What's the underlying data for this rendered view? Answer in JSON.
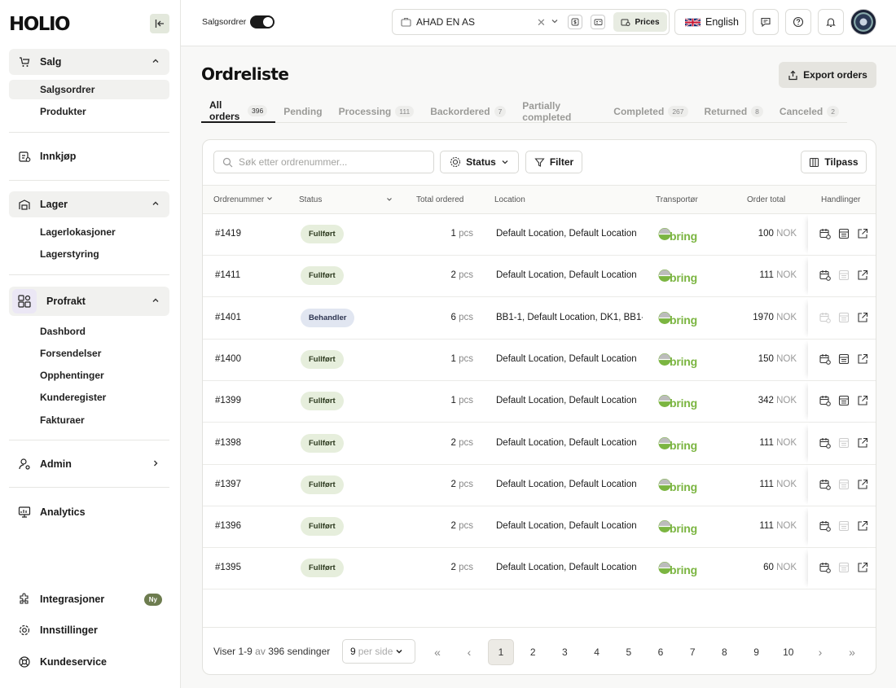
{
  "app": {
    "logo": "HOLIO"
  },
  "sidebar": {
    "groups": {
      "salg": "Salg",
      "innkjop": "Innkjøp",
      "lager": "Lager",
      "profrakt": "Profrakt",
      "admin": "Admin",
      "analytics": "Analytics",
      "integrasjoner": "Integrasjoner",
      "innstillinger": "Innstillinger",
      "kundeservice": "Kundeservice"
    },
    "salg_items": [
      "Salgsordrer",
      "Produkter"
    ],
    "lager_items": [
      "Lagerlokasjoner",
      "Lagerstyring"
    ],
    "profrakt_items": [
      "Dashbord",
      "Forsendelser",
      "Opphentinger",
      "Kunderegister",
      "Fakturaer"
    ],
    "new_badge": "Ny"
  },
  "topbar": {
    "toggle_label": "Salgsordrer",
    "company": "AHAD EN AS",
    "prices_label": "Prices",
    "language": "English"
  },
  "page": {
    "title": "Ordreliste",
    "export_label": "Export orders"
  },
  "tabs": [
    {
      "label": "All orders",
      "count": "396"
    },
    {
      "label": "Pending",
      "count": ""
    },
    {
      "label": "Processing",
      "count": "111"
    },
    {
      "label": "Backordered",
      "count": "7"
    },
    {
      "label": "Partially completed",
      "count": ""
    },
    {
      "label": "Completed",
      "count": "267"
    },
    {
      "label": "Returned",
      "count": "8"
    },
    {
      "label": "Canceled",
      "count": "2"
    }
  ],
  "toolbar": {
    "search_placeholder": "Søk etter ordrenummer...",
    "status_label": "Status",
    "filter_label": "Filter",
    "customize_label": "Tilpass"
  },
  "table": {
    "headers": [
      "Ordrenummer",
      "Status",
      "Total ordered",
      "Location",
      "Transportør",
      "Order total",
      "Handlinger"
    ],
    "carrier_name": "bring",
    "rows": [
      {
        "order": "#1419",
        "status": "Fullført",
        "qty": "1",
        "unit": "pcs",
        "location": "Default Location, Default Location",
        "total": "100",
        "currency": "NOK"
      },
      {
        "order": "#1411",
        "status": "Fullført",
        "qty": "2",
        "unit": "pcs",
        "location": "Default Location, Default Location",
        "total": "111",
        "currency": "NOK"
      },
      {
        "order": "#1401",
        "status": "Behandler",
        "qty": "6",
        "unit": "pcs",
        "location": "BB1-1, Default Location, DK1, BB1-",
        "total": "1970",
        "currency": "NOK"
      },
      {
        "order": "#1400",
        "status": "Fullført",
        "qty": "1",
        "unit": "pcs",
        "location": "Default Location, Default Location",
        "total": "150",
        "currency": "NOK"
      },
      {
        "order": "#1399",
        "status": "Fullført",
        "qty": "1",
        "unit": "pcs",
        "location": "Default Location, Default Location",
        "total": "342",
        "currency": "NOK"
      },
      {
        "order": "#1398",
        "status": "Fullført",
        "qty": "2",
        "unit": "pcs",
        "location": "Default Location, Default Location",
        "total": "111",
        "currency": "NOK"
      },
      {
        "order": "#1397",
        "status": "Fullført",
        "qty": "2",
        "unit": "pcs",
        "location": "Default Location, Default Location",
        "total": "111",
        "currency": "NOK"
      },
      {
        "order": "#1396",
        "status": "Fullført",
        "qty": "2",
        "unit": "pcs",
        "location": "Default Location, Default Location",
        "total": "111",
        "currency": "NOK"
      },
      {
        "order": "#1395",
        "status": "Fullført",
        "qty": "2",
        "unit": "pcs",
        "location": "Default Location, Default Location",
        "total": "60",
        "currency": "NOK"
      }
    ]
  },
  "pagination": {
    "showing_prefix": "Viser 1-9",
    "showing_mid": "av",
    "showing_total": "396",
    "showing_suffix": "sendinger",
    "per_page_value": "9",
    "per_page_label": "per side",
    "first": "«",
    "prev": "‹",
    "next": "›",
    "last": "»",
    "pages": [
      "1",
      "2",
      "3",
      "4",
      "5",
      "6",
      "7",
      "8",
      "9",
      "10"
    ],
    "current": "1"
  },
  "colors": {
    "accent": "#6d7c4f",
    "done_bg": "#e6eedc",
    "processing_bg": "#e1e6f1",
    "bring_green": "#7bb541"
  }
}
